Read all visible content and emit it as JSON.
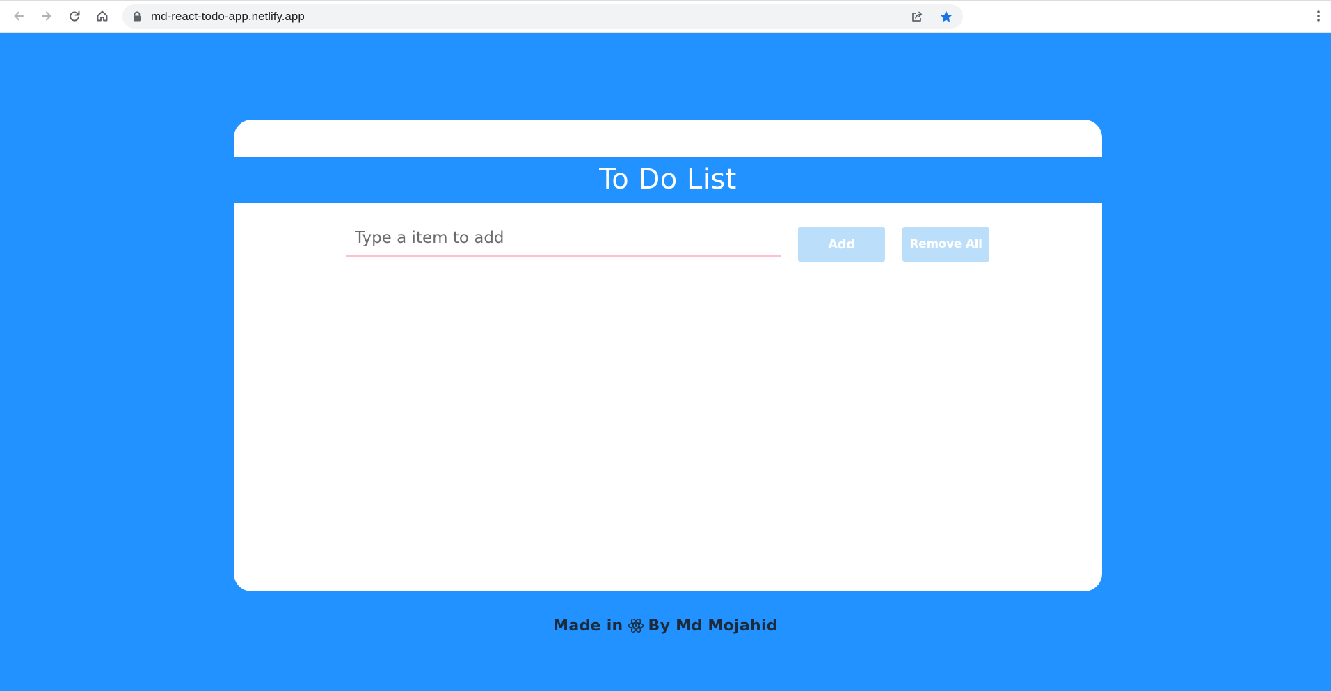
{
  "browser": {
    "url": "md-react-todo-app.netlify.app",
    "star_color": "#1a73e8"
  },
  "app": {
    "title": "To Do List",
    "input_placeholder": "Type a item to add",
    "input_value": "",
    "add_label": "Add",
    "remove_all_label": "Remove All",
    "items": []
  },
  "footer": {
    "made_in": "Made in",
    "by": "By Md Mojahid"
  },
  "colors": {
    "page_background": "#2192ff",
    "card_background": "#ffffff",
    "button_background": "#bbdefb",
    "input_underline": "#ffc0cb"
  },
  "icons": {
    "back": "arrow-left-icon",
    "forward": "arrow-right-icon",
    "reload": "reload-icon",
    "home": "home-icon",
    "lock": "lock-icon",
    "share": "share-icon",
    "bookmark": "star-icon",
    "menu": "kebab-menu-icon",
    "footer_logo": "react-atom-icon"
  }
}
